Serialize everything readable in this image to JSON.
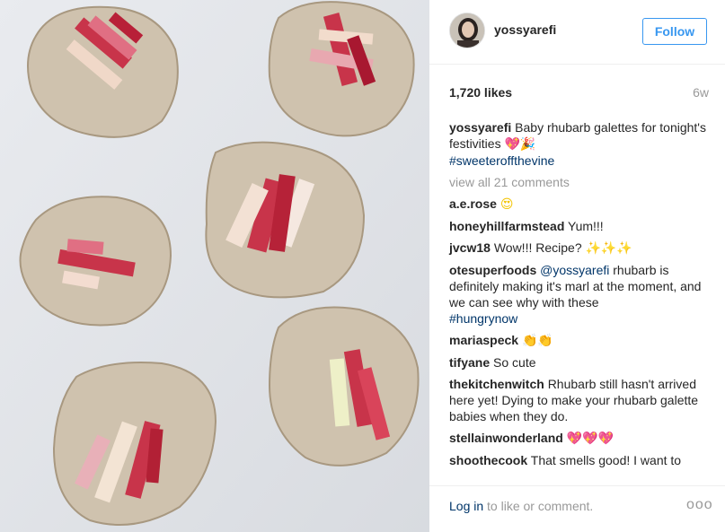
{
  "post": {
    "image_alt": "rhubarb galettes",
    "username": "yossyarefi",
    "follow_label": "Follow",
    "likes": "1,720 likes",
    "age": "6w"
  },
  "caption": {
    "user": "yossyarefi",
    "text": "Baby rhubarb galettes for tonight's festivities",
    "emoji": "💖🎉",
    "hashtag": "#sweeteroffthevine"
  },
  "view_all": "view all 21 comments",
  "comments": [
    {
      "user": "a.e.rose",
      "text": "",
      "emoji": "😍"
    },
    {
      "user": "honeyhillfarmstead",
      "text": "Yum!!!",
      "emoji": ""
    },
    {
      "user": "jvcw18",
      "text": "Wow!!! Recipe?",
      "emoji": "✨✨✨"
    },
    {
      "user": "otesuperfoods",
      "mention": "@yossyarefi",
      "text": "rhubarb is definitely making it's marl at the moment, and we can see why with these",
      "hashtag": "#hungrynow"
    },
    {
      "user": "mariaspeck",
      "text": "",
      "emoji": "👏👏"
    },
    {
      "user": "tifyane",
      "text": "So cute",
      "emoji": ""
    },
    {
      "user": "thekitchenwitch",
      "text": "Rhubarb still hasn't arrived here yet! Dying to make your rhubarb galette babies when they do.",
      "emoji": ""
    },
    {
      "user": "stellainwonderland",
      "text": "",
      "emoji": "💖💖💖"
    },
    {
      "user": "shoothecook",
      "text": "That smells good! I want to",
      "emoji": ""
    }
  ],
  "footer": {
    "login_link": "Log in",
    "login_rest": " to like or comment.",
    "more_glyph": "ooo"
  },
  "colors": {
    "accent": "#3897f0",
    "link": "#003569",
    "muted": "#999999",
    "text": "#262626"
  }
}
